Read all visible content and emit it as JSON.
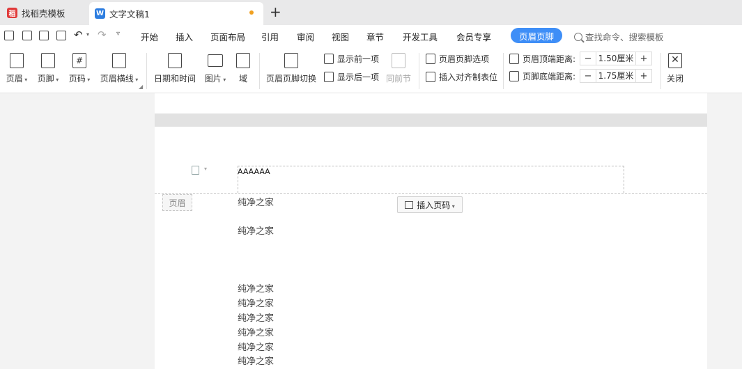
{
  "tabs": [
    {
      "label": "找稻壳模板",
      "icon": "dk",
      "icon_color": "#e03a3a"
    },
    {
      "label": "文字文稿1",
      "icon": "W",
      "icon_color": "#2d7de0",
      "modified_dot_color": "#f0a020"
    }
  ],
  "tab_add": "+",
  "menu": [
    "开始",
    "插入",
    "页面布局",
    "引用",
    "审阅",
    "视图",
    "章节",
    "开发工具",
    "会员专享"
  ],
  "menu_active": "页眉页脚",
  "menu_active_color": "#3e8ef7",
  "search_placeholder": "查找命令、搜索模板",
  "ribbon": {
    "header": "页眉",
    "footer": "页脚",
    "page_num": "页码",
    "header_line": "页眉横线",
    "date_time": "日期和时间",
    "picture": "图片",
    "field": "域",
    "switch": "页眉页脚切换",
    "show_prev": "显示前一项",
    "show_next": "显示后一项",
    "same_as_prev": "同前节",
    "options": "页眉页脚选项",
    "insert_align_tab": "插入对齐制表位",
    "header_top_label": "页眉顶端距离:",
    "header_top_value": "1.50厘米",
    "footer_bottom_label": "页脚底端距离:",
    "footer_bottom_value": "1.75厘米",
    "minus": "−",
    "plus": "+",
    "close": "关闭"
  },
  "document": {
    "header_text": "AAAAAA",
    "header_tag": "页眉",
    "insert_page_num": "插入页码",
    "lines": [
      "纯净之家",
      "纯净之家",
      "纯净之家",
      "纯净之家",
      "纯净之家",
      "纯净之家",
      "纯净之家",
      "纯净之家"
    ]
  }
}
